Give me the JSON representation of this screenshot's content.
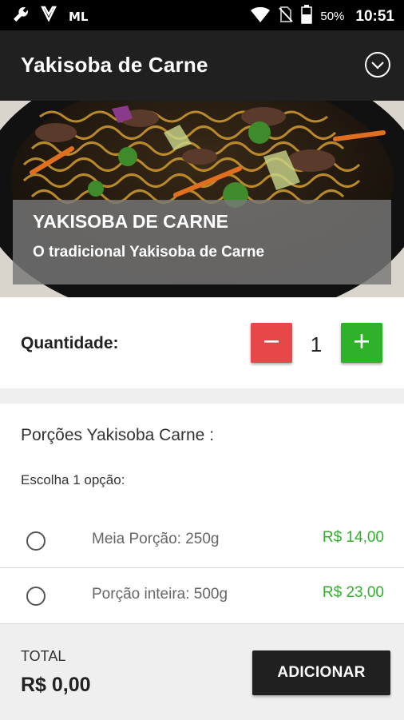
{
  "status_bar": {
    "carrier": "ML",
    "battery": "50%",
    "time": "10:51",
    "icons": [
      "wrench-icon",
      "signal-check-icon",
      "wifi-icon",
      "no-sim-icon",
      "battery-icon"
    ]
  },
  "app_bar": {
    "title": "Yakisoba de Carne",
    "dropdown_icon": "chevron-down-circle-icon"
  },
  "hero": {
    "name": "YAKISOBA DE CARNE",
    "description": "O tradicional Yakisoba de Carne"
  },
  "quantity": {
    "label": "Quantidade:",
    "value": "1",
    "minus_icon": "minus-icon",
    "plus_icon": "plus-icon"
  },
  "options": {
    "title": "Porções Yakisoba Carne :",
    "instruction": "Escolha 1 opção:",
    "items": [
      {
        "name": "Meia Porção: 250g",
        "price": "R$ 14,00",
        "selected": false
      },
      {
        "name": "Porção inteira: 500g",
        "price": "R$ 23,00",
        "selected": false
      }
    ]
  },
  "footer": {
    "total_label": "TOTAL",
    "total_value": "R$ 0,00",
    "add_button": "ADICIONAR"
  },
  "colors": {
    "app_bar": "#202020",
    "minus_button": "#e8474a",
    "plus_button": "#2fb12a",
    "price": "#2fb12a"
  }
}
